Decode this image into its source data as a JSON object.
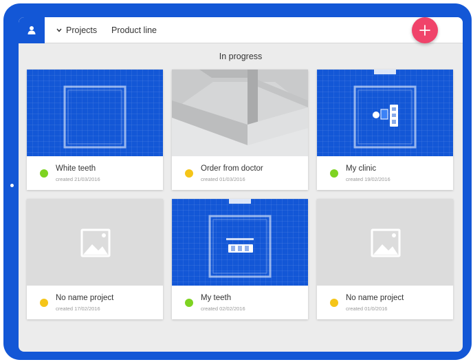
{
  "header": {
    "projects_label": "Projects",
    "product_line_label": "Product line"
  },
  "section": {
    "title": "In progress"
  },
  "status_colors": {
    "green": "#7ed321",
    "yellow": "#f5c518"
  },
  "cards": [
    {
      "title": "White teeth",
      "date": "created 21/03/2016",
      "status": "green",
      "thumbnail": "blueprint-frame"
    },
    {
      "title": "Order from doctor",
      "date": "created 01/03/2016",
      "status": "yellow",
      "thumbnail": "3d-box-render"
    },
    {
      "title": "My clinic",
      "date": "created 19/02/2016",
      "status": "green",
      "thumbnail": "blueprint-with-toolbar"
    },
    {
      "title": "No name project",
      "date": "created 17/02/2016",
      "status": "yellow",
      "thumbnail": "image-placeholder"
    },
    {
      "title": "My teeth",
      "date": "created 02/02/2016",
      "status": "green",
      "thumbnail": "blueprint-with-tools"
    },
    {
      "title": "No name project",
      "date": "created 01/0/2016",
      "status": "yellow",
      "thumbnail": "image-placeholder"
    }
  ]
}
